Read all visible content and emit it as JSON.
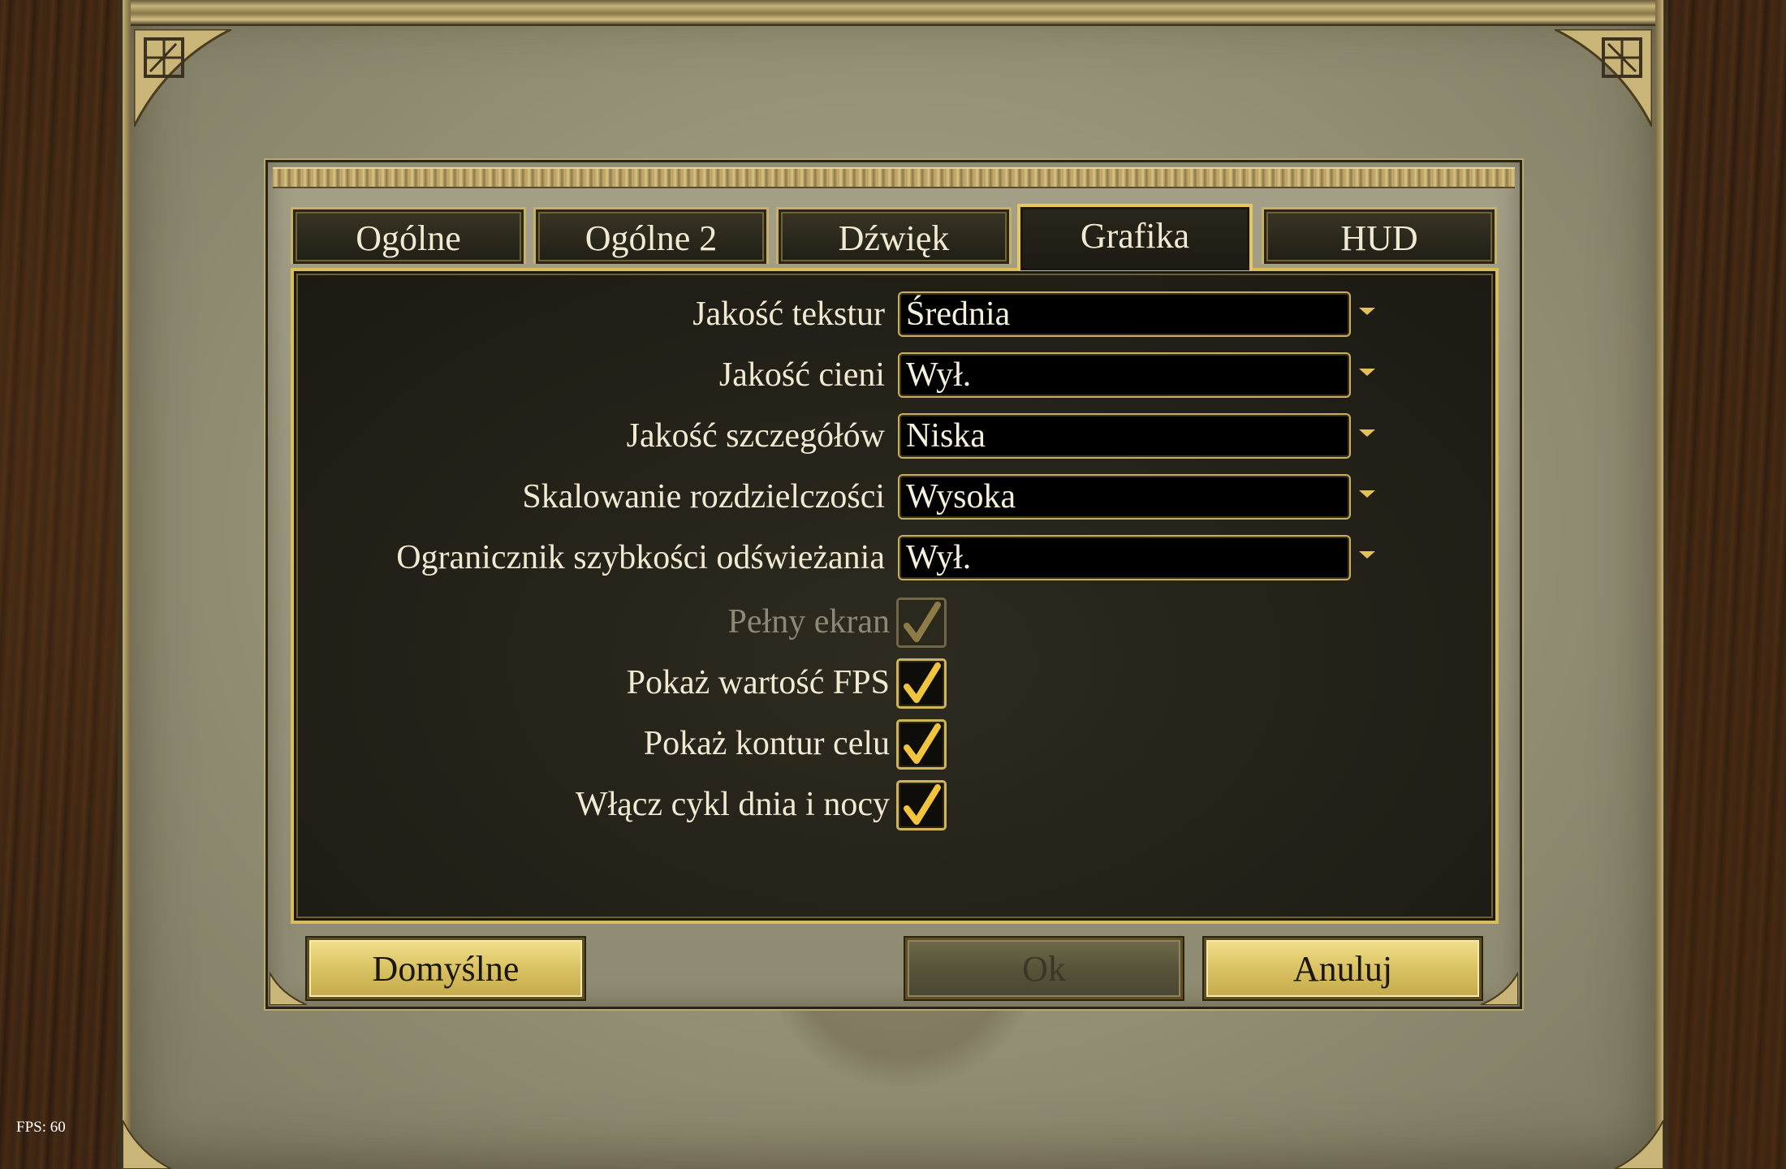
{
  "overlay": {
    "fps_text": "FPS: 60"
  },
  "tabs": [
    {
      "label": "Ogólne",
      "active": false
    },
    {
      "label": "Ogólne 2",
      "active": false
    },
    {
      "label": "Dźwięk",
      "active": false
    },
    {
      "label": "Grafika",
      "active": true
    },
    {
      "label": "HUD",
      "active": false
    }
  ],
  "settings": {
    "dropdowns": [
      {
        "label": "Jakość tekstur",
        "value": "Średnia"
      },
      {
        "label": "Jakość cieni",
        "value": "Wył."
      },
      {
        "label": "Jakość szczegółów",
        "value": "Niska"
      },
      {
        "label": "Skalowanie rozdzielczości",
        "value": "Wysoka"
      },
      {
        "label": "Ogranicznik szybkości odświeżania",
        "value": "Wył."
      }
    ],
    "checkboxes": [
      {
        "label": "Pełny ekran",
        "checked": true,
        "enabled": false
      },
      {
        "label": "Pokaż wartość FPS",
        "checked": true,
        "enabled": true
      },
      {
        "label": "Pokaż kontur celu",
        "checked": true,
        "enabled": true
      },
      {
        "label": "Włącz cykl dnia i nocy",
        "checked": true,
        "enabled": true
      }
    ]
  },
  "buttons": {
    "defaults_label": "Domyślne",
    "ok_label": "Ok",
    "ok_enabled": false,
    "cancel_label": "Anuluj"
  },
  "colors": {
    "accent_gold": "#d9bd5a",
    "panel_dark": "#232118",
    "text_light": "#f1ead3",
    "disabled_text": "#8e8877"
  },
  "icons": {
    "checkmark": "checkmark-icon",
    "dropdown_arrow": "chevron-down-icon"
  }
}
